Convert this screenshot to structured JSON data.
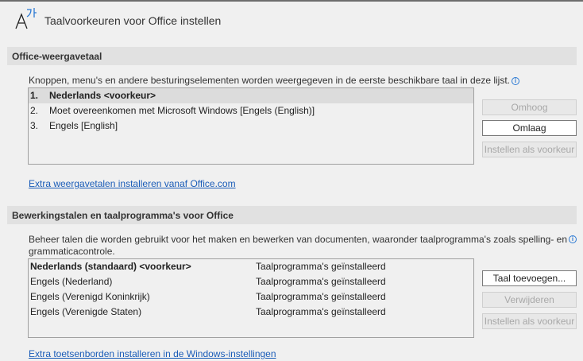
{
  "header": {
    "title": "Taalvoorkeuren voor Office instellen",
    "icon": "language-icon"
  },
  "display": {
    "heading": "Office-weergavetaal",
    "description": "Knoppen, menu's en andere besturingselementen worden weergegeven in de eerste beschikbare taal in deze lijst.",
    "items": [
      {
        "num": "1.",
        "label": "Nederlands <voorkeur>"
      },
      {
        "num": "2.",
        "label": "Moet overeenkomen met Microsoft Windows [Engels (English)]"
      },
      {
        "num": "3.",
        "label": "Engels [English]"
      }
    ],
    "buttons": {
      "up": "Omhoog",
      "down": "Omlaag",
      "preferred": "Instellen als voorkeur"
    },
    "link": "Extra weergavetalen installeren vanaf Office.com"
  },
  "editing": {
    "heading": "Bewerkingstalen en taalprogramma's voor Office",
    "description": "Beheer talen die worden gebruikt voor het maken en bewerken van documenten, waaronder taalprogramma's zoals spelling- en grammaticacontrole.",
    "items": [
      {
        "lang": "Nederlands (standaard) <voorkeur>",
        "status": "Taalprogramma's geïnstalleerd"
      },
      {
        "lang": "Engels (Nederland)",
        "status": "Taalprogramma's geïnstalleerd"
      },
      {
        "lang": "Engels (Verenigd Koninkrijk)",
        "status": "Taalprogramma's geïnstalleerd"
      },
      {
        "lang": "Engels (Verenigde Staten)",
        "status": "Taalprogramma's geïnstalleerd"
      }
    ],
    "buttons": {
      "add": "Taal toevoegen...",
      "remove": "Verwijderen",
      "preferred": "Instellen als voorkeur"
    },
    "link": "Extra toetsenborden installeren in de Windows-instellingen"
  }
}
